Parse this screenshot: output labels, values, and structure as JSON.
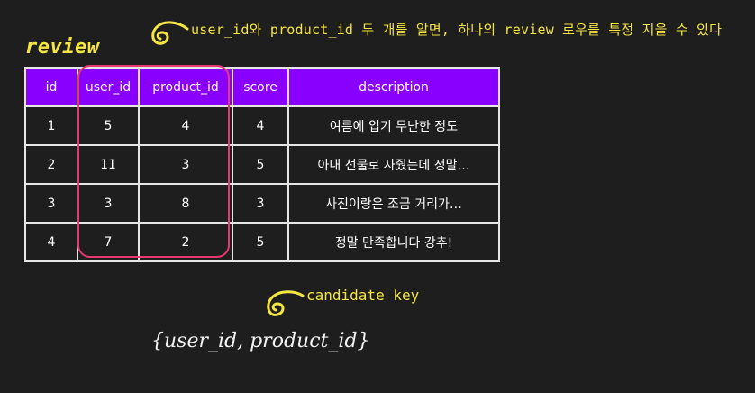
{
  "annotations": {
    "top_note": "user_id와 product_id 두 개를 알면, 하나의 review 로우를 특정 지을 수 있다",
    "candidate_key_label": "candidate key"
  },
  "table": {
    "title": "review",
    "headers": {
      "id": "id",
      "user_id": "user_id",
      "product_id": "product_id",
      "score": "score",
      "description": "description"
    },
    "rows": [
      {
        "id": "1",
        "user_id": "5",
        "product_id": "4",
        "score": "4",
        "description": "여름에 입기 무난한 정도"
      },
      {
        "id": "2",
        "user_id": "11",
        "product_id": "3",
        "score": "5",
        "description": "아내 선물로 사줬는데 정말…"
      },
      {
        "id": "3",
        "user_id": "3",
        "product_id": "8",
        "score": "3",
        "description": "사진이랑은 조금 거리가…"
      },
      {
        "id": "4",
        "user_id": "7",
        "product_id": "2",
        "score": "5",
        "description": "정말 만족합니다 강추!"
      }
    ]
  },
  "formula": "{user_id, product_id}",
  "colors": {
    "background": "#1e1e1e",
    "header_bg": "#8a00ff",
    "highlight": "#e8386f",
    "annotation": "#f5e642"
  }
}
